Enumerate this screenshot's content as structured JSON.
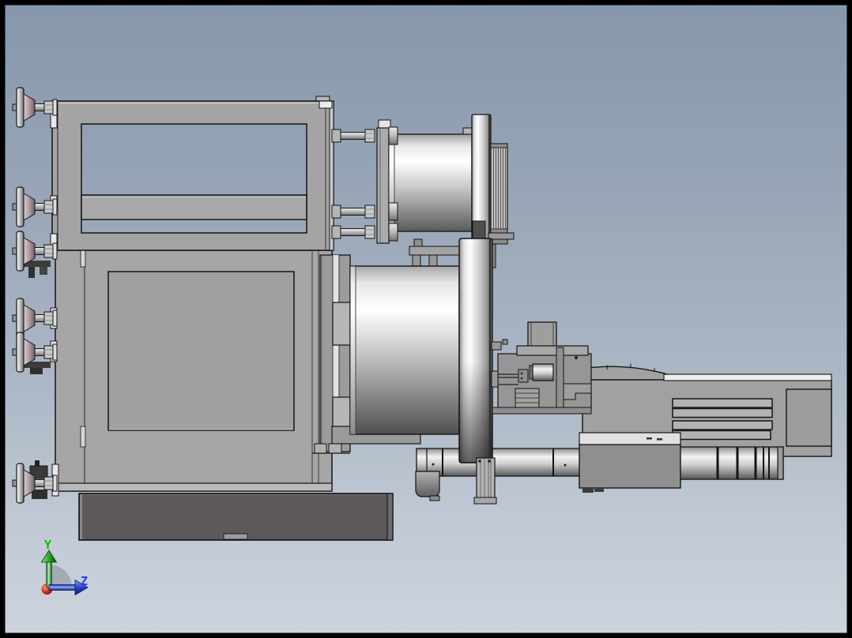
{
  "scene": {
    "description": "3D CAD side view of a machine assembly",
    "view_orientation": "side (looking along X axis)",
    "background": {
      "top": "#8697ac",
      "upper_mid": "#97a5b6",
      "lower_mid": "#aeb9c7",
      "bottom": "#cdd4dd"
    },
    "frame_border_color": "#000000"
  },
  "triad": {
    "y_axis": {
      "label": "Y",
      "color": "#00c400"
    },
    "z_axis": {
      "label": "Z",
      "color": "#2340dd"
    },
    "x_axis": {
      "label": "",
      "color": "#c42015"
    }
  },
  "machine": {
    "body_color": "#a4a4a4",
    "base_color": "#5c585b",
    "outline_color": "#141414",
    "metal_highlight": "#ffffff",
    "parts": [
      "upper frame panel with window",
      "lower door panel",
      "dark base plate",
      "leveling knobs (left edge)",
      "tie rods with nuts",
      "upper drum cylinder",
      "upper flange disc",
      "cooling fin block",
      "lower drum cylinder",
      "large front flange disc",
      "drive shaft",
      "support leg",
      "tool bracket assembly",
      "vented gear housing",
      "ribbed coupling",
      "motor mount block"
    ]
  }
}
